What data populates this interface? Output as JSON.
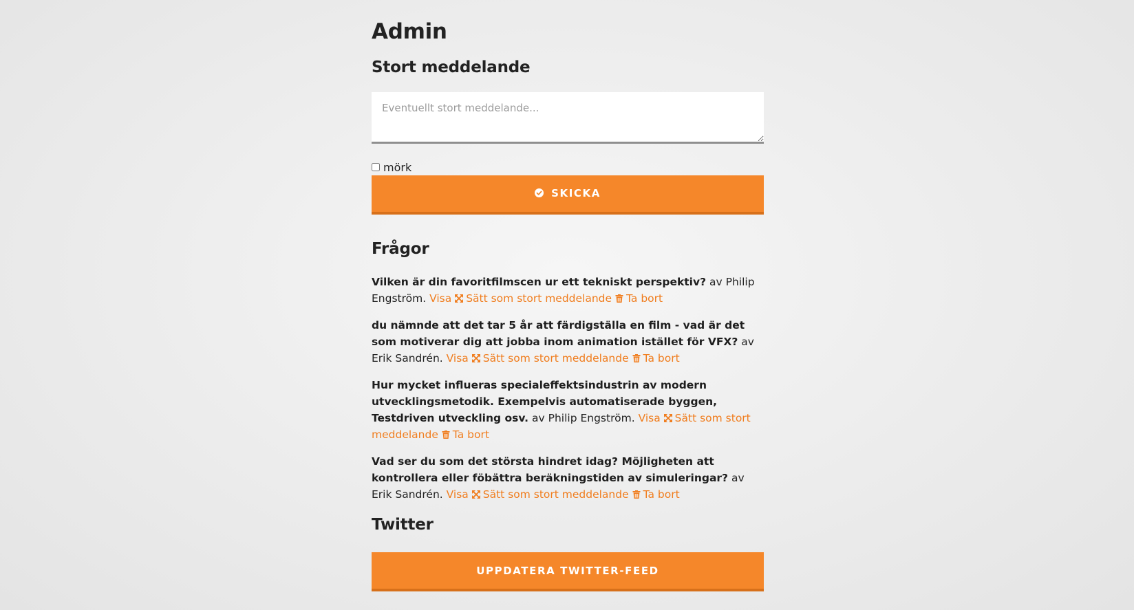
{
  "page": {
    "title": "Admin"
  },
  "message": {
    "heading": "Stort meddelande",
    "placeholder": "Eventuellt stort meddelande...",
    "value": "",
    "dark_label": "mörk",
    "dark_checked": false,
    "send_label": "Skicka",
    "send_icon": "check-circle-icon"
  },
  "questions": {
    "heading": "Frågor",
    "author_prefix": "av",
    "view_label": "Visa",
    "set_label": "Sätt som stort meddelande",
    "delete_label": "Ta bort",
    "items": [
      {
        "text": "Vilken är din favoritfilmscen ur ett tekniskt perspektiv?",
        "author": "Philip Engström."
      },
      {
        "text": "du nämnde att det tar 5 år att färdigställa en film - vad är det som motiverar dig att jobba inom animation istället för VFX?",
        "author": "Erik Sandrén."
      },
      {
        "text": "Hur mycket influeras specialeffektsindustrin av modern utvecklingsmetodik. Exempelvis automatiserade byggen, Testdriven utveckling osv.",
        "author": "Philip Engström."
      },
      {
        "text": "Vad ser du som det största hindret idag? Möjligheten att kontrollera eller föbättra beräkningstiden av simuleringar?",
        "author": "Erik Sandrén."
      }
    ]
  },
  "twitter": {
    "heading": "Twitter",
    "update_label": "Uppdatera Twitter-feed"
  },
  "colors": {
    "accent": "#f5872a",
    "accent_dark": "#d7701a",
    "link": "#f07d1e",
    "text": "#222222",
    "background": "#ececec"
  }
}
